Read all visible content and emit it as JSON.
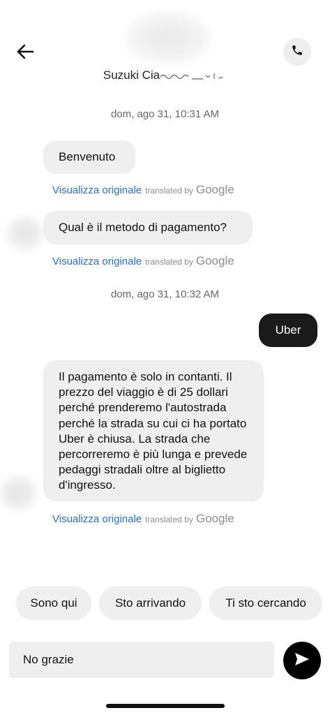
{
  "header": {
    "contact_name": "Suzuki Cia",
    "back_icon": "arrow-left-icon",
    "call_icon": "phone-icon"
  },
  "messages": [
    {
      "type": "timestamp",
      "text": "dom, ago 31, 10:31 AM"
    },
    {
      "type": "incoming",
      "text": "Benvenuto"
    },
    {
      "type": "incoming",
      "text": "Qual è il metodo di pagamento?"
    },
    {
      "type": "timestamp",
      "text": "dom, ago 31, 10:32 AM"
    },
    {
      "type": "outgoing",
      "text": "Uber"
    },
    {
      "type": "incoming",
      "text": "Il pagamento è solo in contanti. Il prezzo del viaggio è di 25 dollari perché prenderemo l'autostrada perché la strada su cui ci ha portato Uber è chiusa. La strada che percorreremo è più lunga e prevede pedaggi stradali oltre al biglietto d'ingresso."
    }
  ],
  "translation": {
    "link_label": "Visualizza originale",
    "translated_by": "translated by",
    "provider": "Google"
  },
  "quick_replies": [
    "Sono qui",
    "Sto arrivando",
    "Ti sto cercando"
  ],
  "composer": {
    "value": "No grazie",
    "send_icon": "send-icon"
  },
  "colors": {
    "link": "#276ef1",
    "bubble_in": "#efefef",
    "bubble_out": "#1a1a1a"
  }
}
